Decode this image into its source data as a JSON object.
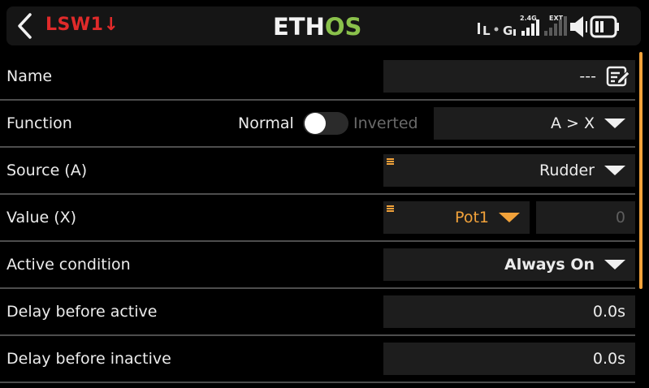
{
  "header": {
    "title": "LSW1↓",
    "logo_main": "ETH",
    "logo_accent": "OS",
    "status": {
      "rx_label": "L",
      "gps_label": "G",
      "band_label": "2.4G",
      "ext_label": "EXT",
      "speaker_icon": "speaker-icon",
      "battery_icon": "battery-icon"
    }
  },
  "form": {
    "name": {
      "label": "Name",
      "value": "---"
    },
    "function": {
      "label": "Function",
      "toggle_left": "Normal",
      "toggle_right": "Inverted",
      "toggle_state": "normal",
      "value": "A > X"
    },
    "source": {
      "label": "Source (A)",
      "value": "Rudder"
    },
    "value_x": {
      "label": "Value (X)",
      "source": "Pot1",
      "number": "0"
    },
    "active_condition": {
      "label": "Active condition",
      "value": "Always On"
    },
    "delay_active": {
      "label": "Delay before active",
      "value": "0.0s"
    },
    "delay_inactive": {
      "label": "Delay before inactive",
      "value": "0.0s"
    }
  },
  "colors": {
    "title_red": "#e02a2a",
    "logo_green": "#8ac14b",
    "accent_orange": "#f2a23a",
    "field_bg": "#1d1d1d",
    "divider": "#4d4d4d"
  }
}
